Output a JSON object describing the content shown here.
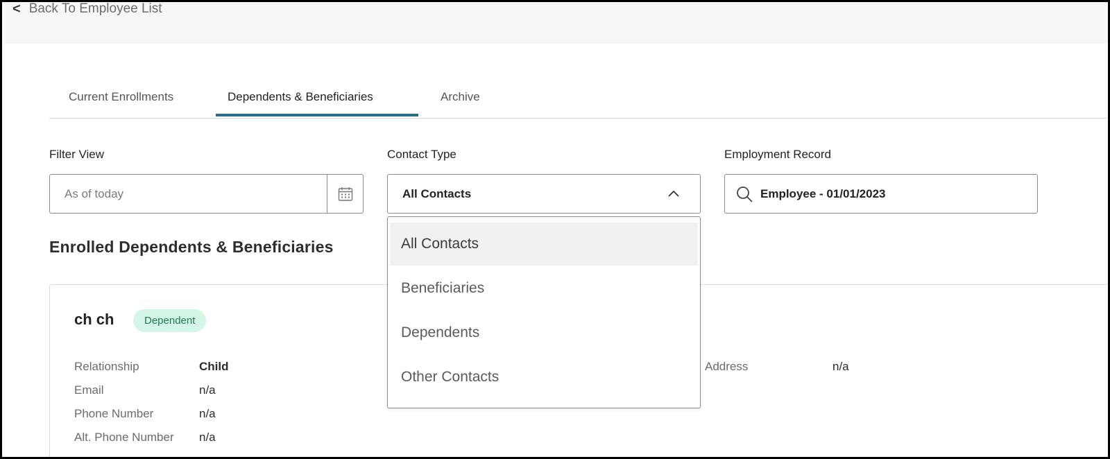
{
  "nav": {
    "back_label": "Back To Employee List"
  },
  "tabs": [
    {
      "label": "Current Enrollments"
    },
    {
      "label": "Dependents & Beneficiaries",
      "active": true
    },
    {
      "label": "Archive"
    }
  ],
  "filters": {
    "filter_view": {
      "label": "Filter View",
      "value": "As of today"
    },
    "contact_type": {
      "label": "Contact Type",
      "value": "All Contacts",
      "options": [
        "All Contacts",
        "Beneficiaries",
        "Dependents",
        "Other Contacts"
      ]
    },
    "employment_record": {
      "label": "Employment Record",
      "value": "Employee - 01/01/2023"
    }
  },
  "section": {
    "title": "Enrolled Dependents & Beneficiaries"
  },
  "card": {
    "name": "ch ch",
    "badge": "Dependent",
    "rows": [
      {
        "label": "Relationship",
        "value": "Child"
      },
      {
        "label": "Email",
        "value": "n/a"
      },
      {
        "label": "Phone Number",
        "value": "n/a"
      },
      {
        "label": "Alt. Phone Number",
        "value": "n/a"
      }
    ],
    "address": {
      "label": "Address",
      "value": "n/a"
    }
  },
  "colors": {
    "accent": "#2a6f85",
    "badge_bg": "#d4f6e6",
    "badge_text": "#1e7a55"
  }
}
